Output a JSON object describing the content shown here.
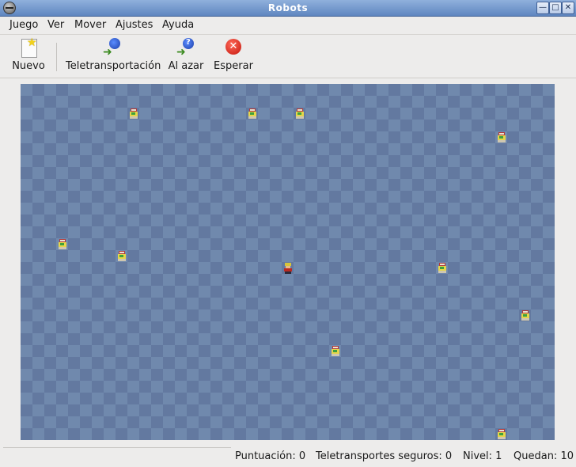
{
  "window": {
    "title": "Robots"
  },
  "menu": [
    {
      "label": "Juego"
    },
    {
      "label": "Ver"
    },
    {
      "label": "Mover"
    },
    {
      "label": "Ajustes"
    },
    {
      "label": "Ayuda"
    }
  ],
  "toolbar": {
    "new_label": "Nuevo",
    "teleport_label": "Teletransportación",
    "random_label": "Al azar",
    "wait_label": "Esperar"
  },
  "status": {
    "score_label": "Puntuación:",
    "score_value": "0",
    "safe_label": "Teletransportes seguros:",
    "safe_value": "0",
    "level_label": "Nivel:",
    "level_value": "1",
    "remaining_label": "Quedan:",
    "remaining_value": "10"
  },
  "colors": {
    "title_bar": "#6f95cd",
    "board_dark": "#6379a0",
    "board_light": "#7089ad"
  }
}
